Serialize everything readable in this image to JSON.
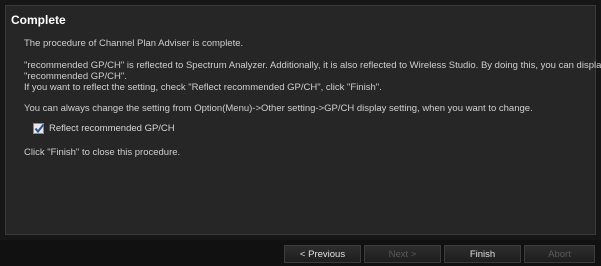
{
  "dialog": {
    "title": "Complete",
    "line1": "The procedure of Channel Plan Adviser is complete.",
    "line2a": "\"recommended GP/CH\" is reflected to Spectrum Analyzer. Additionally, it is also reflected to Wireless Studio. By doing this, you can display only",
    "line2b": "\"recommended GP/CH\".",
    "line2c": "If you want to reflect the setting, check \"Reflect recommended GP/CH\", click \"Finish\".",
    "line3": "You can always change the setting from Option(Menu)->Other setting->GP/CH display setting, when you want to change.",
    "checkbox_label": "Reflect recommended GP/CH",
    "checkbox_checked": true,
    "line4": "Click \"Finish\" to close this procedure."
  },
  "footer": {
    "previous_label": "< Previous",
    "next_label": "Next >",
    "finish_label": "Finish",
    "abort_label": "Abort"
  },
  "colors": {
    "background": "#161616",
    "panel": "#262626",
    "text": "#d6d6d6",
    "disabled_text": "#5a5a5a"
  }
}
